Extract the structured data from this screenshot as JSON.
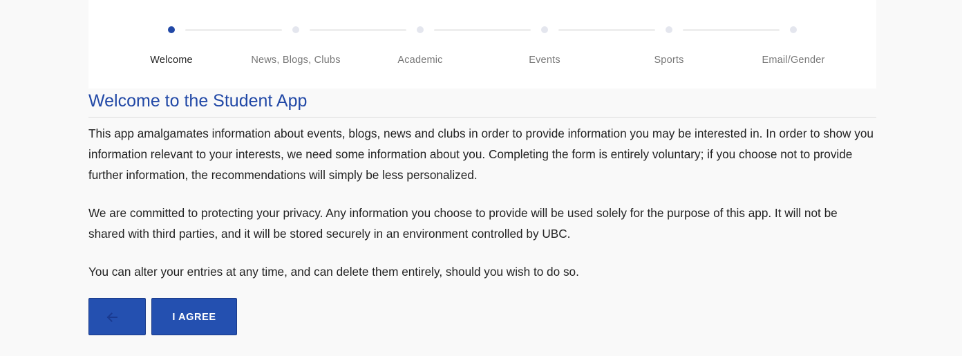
{
  "stepper": {
    "steps": [
      {
        "label": "Welcome",
        "active": true
      },
      {
        "label": "News, Blogs, Clubs",
        "active": false
      },
      {
        "label": "Academic",
        "active": false
      },
      {
        "label": "Events",
        "active": false
      },
      {
        "label": "Sports",
        "active": false
      },
      {
        "label": "Email/Gender",
        "active": false
      }
    ]
  },
  "content": {
    "title": "Welcome to the Student App",
    "paragraphs": [
      "This app amalgamates information about events, blogs, news and clubs in order to provide information you may be interested in. In order to show you information relevant to your interests, we need some information about you. Completing the form is entirely voluntary; if you choose not to provide further information, the recommendations will simply be less personalized.",
      "We are committed to protecting your privacy. Any information you choose to provide will be used solely for the purpose of this app. It will not be shared with third parties, and it will be stored securely in an environment controlled by UBC.",
      "You can alter your entries at any time, and can delete them entirely, should you wish to do so."
    ]
  },
  "actions": {
    "back_icon": "arrow-left-icon",
    "agree_label": "I AGREE"
  },
  "colors": {
    "accent": "#2148a6",
    "button": "#2450b0",
    "inactive_dot": "#e4e6ee",
    "background": "#f9f9f9"
  }
}
